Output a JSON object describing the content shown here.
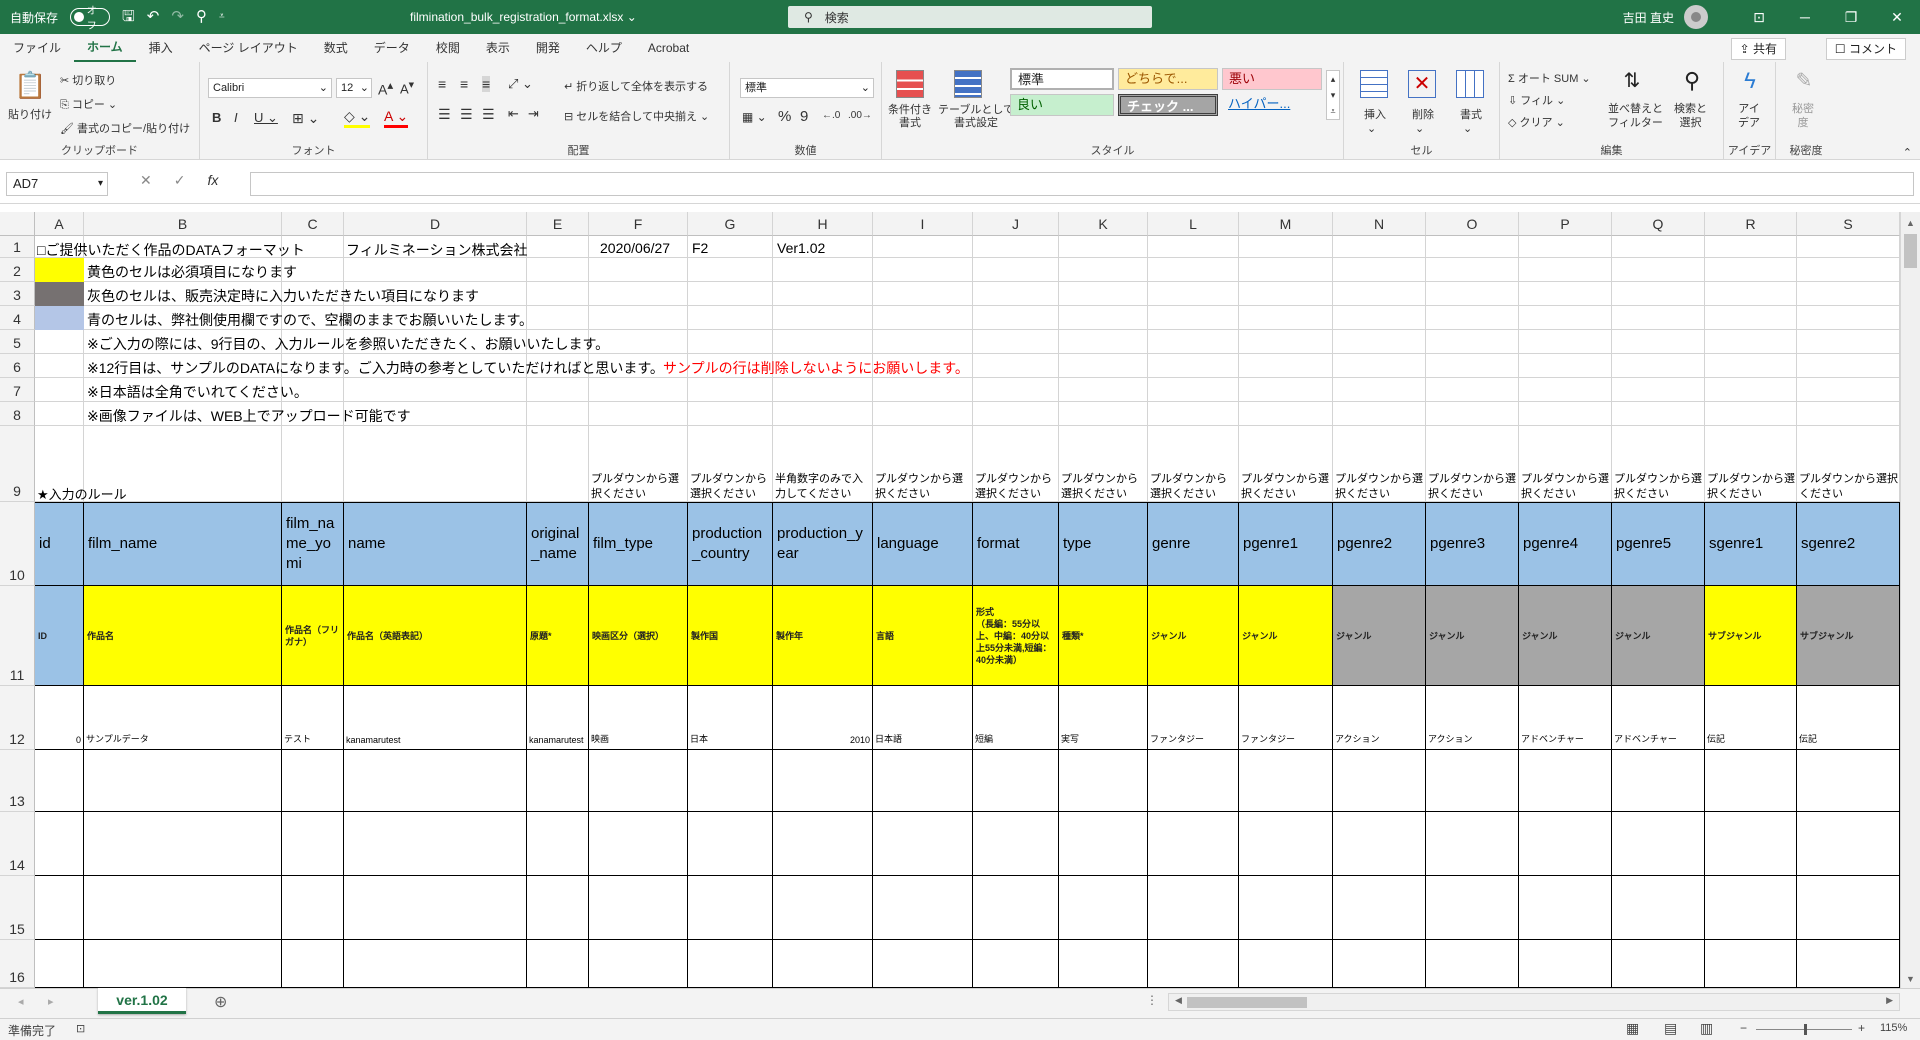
{
  "titlebar": {
    "autosave_label": "自動保存",
    "autosave_state": "オフ",
    "filename": "filmination_bulk_registration_format.xlsx",
    "search_placeholder": "検索",
    "user_name": "吉田 直史"
  },
  "menu": [
    "ファイル",
    "ホーム",
    "挿入",
    "ページ レイアウト",
    "数式",
    "データ",
    "校閲",
    "表示",
    "開発",
    "ヘルプ",
    "Acrobat"
  ],
  "share_label": "共有",
  "comment_label": "コメント",
  "ribbon": {
    "clipboard": {
      "paste": "貼り付け",
      "cut": "切り取り",
      "copy": "コピー",
      "format_painter": "書式のコピー/貼り付け",
      "label": "クリップボード"
    },
    "font": {
      "name": "Calibri",
      "size": "12",
      "label": "フォント"
    },
    "alignment": {
      "wrap": "折り返して全体を表示する",
      "merge": "セルを結合して中央揃え",
      "label": "配置"
    },
    "number": {
      "format": "標準",
      "label": "数値"
    },
    "styles": {
      "cond_format": "条件付き\n書式",
      "table_format": "テーブルとして\n書式設定",
      "s_normal": "標準",
      "s_neutral": "どちらで...",
      "s_bad": "悪い",
      "s_good": "良い",
      "s_check": "チェック ...",
      "s_hyperlink": "ハイパー...",
      "label": "スタイル"
    },
    "cells": {
      "insert": "挿入",
      "delete": "削除",
      "format": "書式",
      "label": "セル"
    },
    "editing": {
      "autosum": "オート SUM",
      "fill": "フィル",
      "clear": "クリア",
      "sort": "並べ替えと\nフィルター",
      "find": "検索と\n選択",
      "label": "編集"
    },
    "ideas": {
      "btn": "アイ\nデア",
      "label": "アイデア"
    },
    "sensitivity": {
      "btn": "秘密\n度",
      "label": "秘密度"
    }
  },
  "formula_bar": {
    "name_box": "AD7",
    "formula": ""
  },
  "columns": [
    "A",
    "B",
    "C",
    "D",
    "E",
    "F",
    "G",
    "H",
    "I",
    "J",
    "K",
    "L",
    "M",
    "N",
    "O",
    "P",
    "Q",
    "R",
    "S"
  ],
  "rows": [
    "1",
    "2",
    "3",
    "4",
    "5",
    "6",
    "7",
    "8",
    "9",
    "10",
    "11",
    "12",
    "13",
    "14",
    "15",
    "16"
  ],
  "sheet": {
    "r1": {
      "a": "□ご提供いただく作品のDATAフォーマット",
      "d": "フィルミネーション株式会社",
      "f": "2020/06/27",
      "g": "F2",
      "h": "Ver1.02"
    },
    "r2": "黄色のセルは必須項目になります",
    "r3": "灰色のセルは、販売決定時に入力いただきたい項目になります",
    "r4": "青のセルは、弊社側使用欄ですので、空欄のままでお願いいたします。",
    "r5": "※ご入力の際には、9行目の、入力ルールを参照いただきたく、お願いいたします。",
    "r6": "※12行目は、サンプルのDATAになります。ご入力時の参考としていただければと思います。",
    "r6_red": "サンプルの行は削除しないようにお願いします。",
    "r7": "※日本語は全角でいれてください。",
    "r8": "※画像ファイルは、WEB上でアップロード可能です",
    "r9_a": "★入力のルール",
    "r9": [
      "",
      "",
      "",
      "",
      "",
      "プルダウンから選択ください",
      "プルダウンから選択ください",
      "半角数字のみで入力してください",
      "プルダウンから選択ください",
      "プルダウンから選択ください",
      "プルダウンから選択ください",
      "プルダウンから選択ください",
      "プルダウンから選択ください",
      "プルダウンから選択ください",
      "プルダウンから選択ください",
      "プルダウンから選択ください",
      "プルダウンから選択ください",
      "プルダウンから選択ください",
      "プルダウンから選択ください"
    ],
    "r10": [
      "id",
      "film_name",
      "film_name_yomi",
      "name",
      "original_name",
      "film_type",
      "production_country",
      "production_year",
      "language",
      "format",
      "type",
      "genre",
      "pgenre1",
      "pgenre2",
      "pgenre3",
      "pgenre4",
      "pgenre5",
      "sgenre1",
      "sgenre2"
    ],
    "r11": [
      "ID",
      "作品名",
      "作品名（フリガナ）",
      "作品名（英語表記）",
      "原題*",
      "映画区分（選択）",
      "製作国",
      "製作年",
      "言語",
      "形式\n（長編：55分以上、中編：40分以上55分未満,短編：40分未満）",
      "種類*",
      "ジャンル",
      "ジャンル",
      "ジャンル",
      "ジャンル",
      "ジャンル",
      "ジャンル",
      "サブジャンル",
      "サブジャンル"
    ],
    "r12": [
      "0",
      "サンプルデータ",
      "テスト",
      "kanamarutest",
      "kanamarutest",
      "映画",
      "日本",
      "2010",
      "日本語",
      "短編",
      "実写",
      "ファンタジー",
      "ファンタジー",
      "アクション",
      "アクション",
      "アドベンチャー",
      "アドベンチャー",
      "伝記",
      "伝記"
    ]
  },
  "sheet_tab": "ver.1.02",
  "status": {
    "ready": "準備完了",
    "zoom": "115%"
  },
  "colors": {
    "excel_green": "#217346",
    "blue_header": "#9bc2e6",
    "yellow": "#ffff00",
    "gray": "#a6a6a6",
    "legend_gray": "#767171",
    "legend_blue": "#b4c6e7",
    "red_text": "#ff0000"
  }
}
